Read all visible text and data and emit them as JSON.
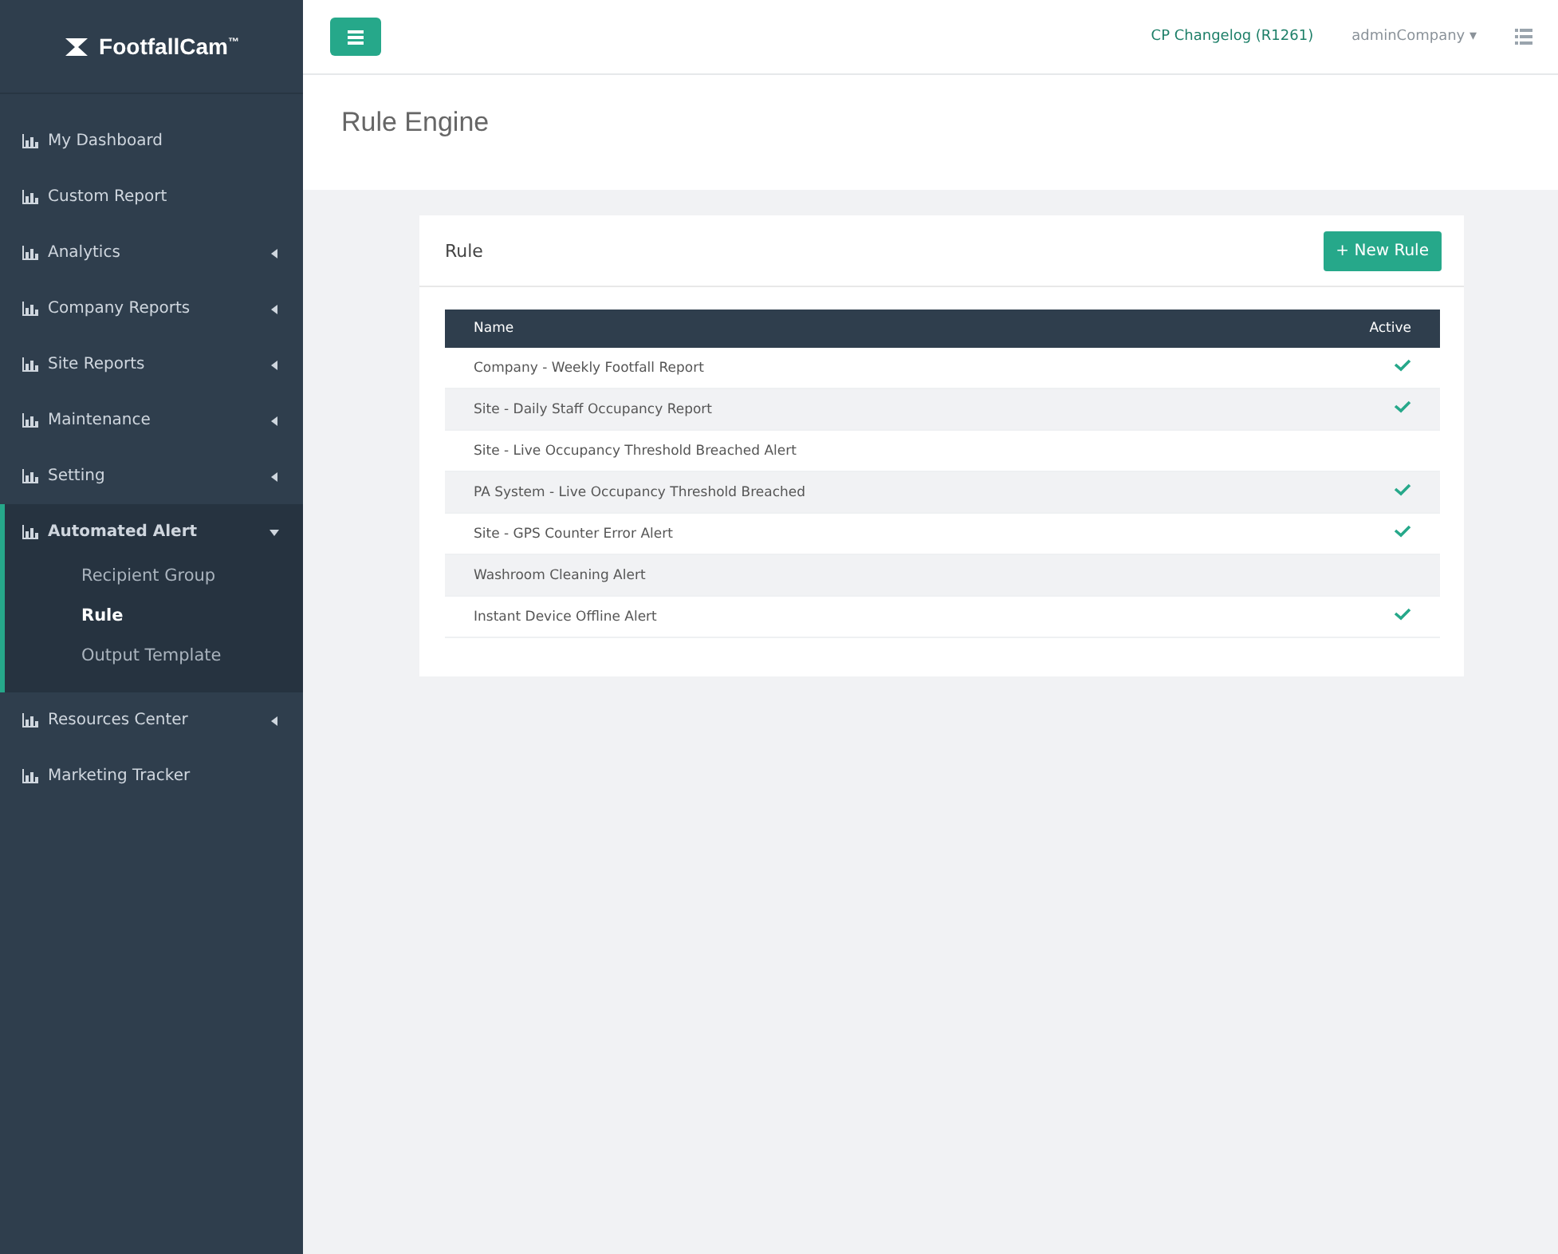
{
  "sidebar": {
    "logo": "FootfallCam",
    "logo_mark": "™",
    "items": [
      {
        "label": "My Dashboard",
        "has_submenu": false,
        "expanded": false
      },
      {
        "label": "Custom Report",
        "has_submenu": false,
        "expanded": false
      },
      {
        "label": "Analytics",
        "has_submenu": true,
        "expanded": false
      },
      {
        "label": "Company Reports",
        "has_submenu": true,
        "expanded": false
      },
      {
        "label": "Site Reports",
        "has_submenu": true,
        "expanded": false
      },
      {
        "label": "Maintenance",
        "has_submenu": true,
        "expanded": false
      },
      {
        "label": "Setting",
        "has_submenu": true,
        "expanded": false
      },
      {
        "label": "Automated Alert",
        "has_submenu": true,
        "expanded": true,
        "children": [
          {
            "label": "Recipient Group",
            "selected": false
          },
          {
            "label": "Rule",
            "selected": true
          },
          {
            "label": "Output Template",
            "selected": false
          }
        ]
      },
      {
        "label": "Resources Center",
        "has_submenu": true,
        "expanded": false
      },
      {
        "label": "Marketing Tracker",
        "has_submenu": false,
        "expanded": false
      }
    ]
  },
  "topbar": {
    "changelog": "CP Changelog (R1261)",
    "user": "adminCompany",
    "user_caret": "▾"
  },
  "page_title": "Rule Engine",
  "card": {
    "title": "Rule",
    "button": "+ New Rule",
    "table": {
      "columns": [
        "Name",
        "Active"
      ],
      "rows": [
        {
          "name": "Company - Weekly Footfall Report",
          "active": true
        },
        {
          "name": "Site - Daily Staff Occupancy Report",
          "active": true
        },
        {
          "name": "Site - Live Occupancy Threshold Breached Alert",
          "active": false
        },
        {
          "name": "PA System - Live Occupancy Threshold Breached",
          "active": true
        },
        {
          "name": "Site - GPS Counter Error Alert",
          "active": true
        },
        {
          "name": "Washroom Cleaning Alert",
          "active": false
        },
        {
          "name": "Instant Device Offline Alert",
          "active": true
        }
      ]
    }
  }
}
